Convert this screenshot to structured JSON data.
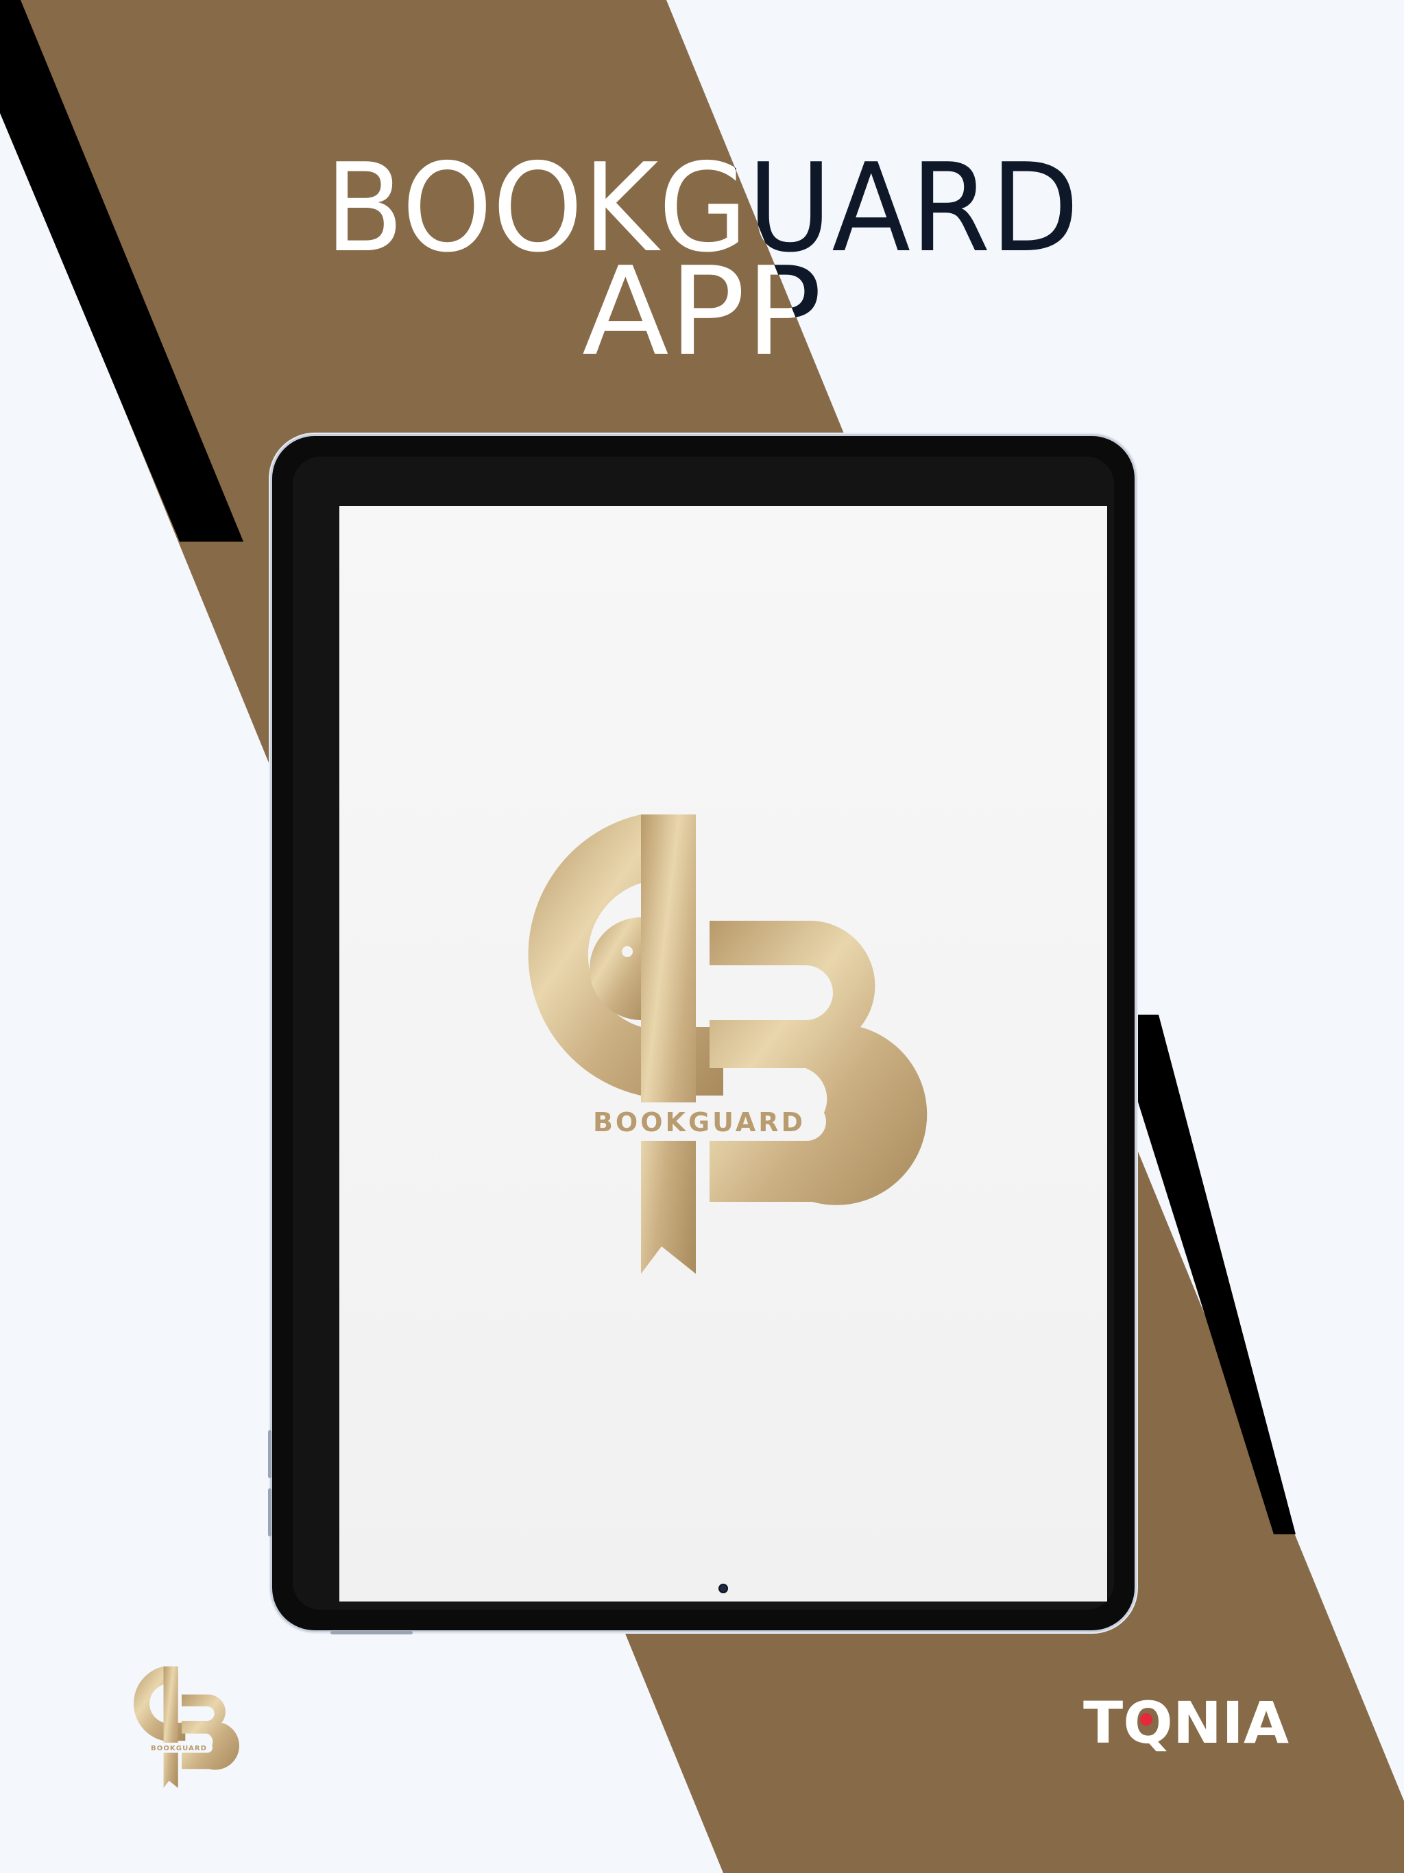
{
  "headline": {
    "line1": "BOOKGUARD",
    "line2": "APP"
  },
  "screen_logo": {
    "wordmark": "BOOKGUARD"
  },
  "footer_logo": {
    "wordmark": "BOOKGUARD"
  },
  "brand": {
    "name": "TQNIA"
  },
  "colors": {
    "background": "#f4f7fc",
    "band": "#876a48",
    "stripe": "#000000",
    "headline_dark": "#0f1828",
    "headline_light": "#ffffff",
    "gold": "#c9ac7c",
    "brand_accent": "#e5283a"
  }
}
